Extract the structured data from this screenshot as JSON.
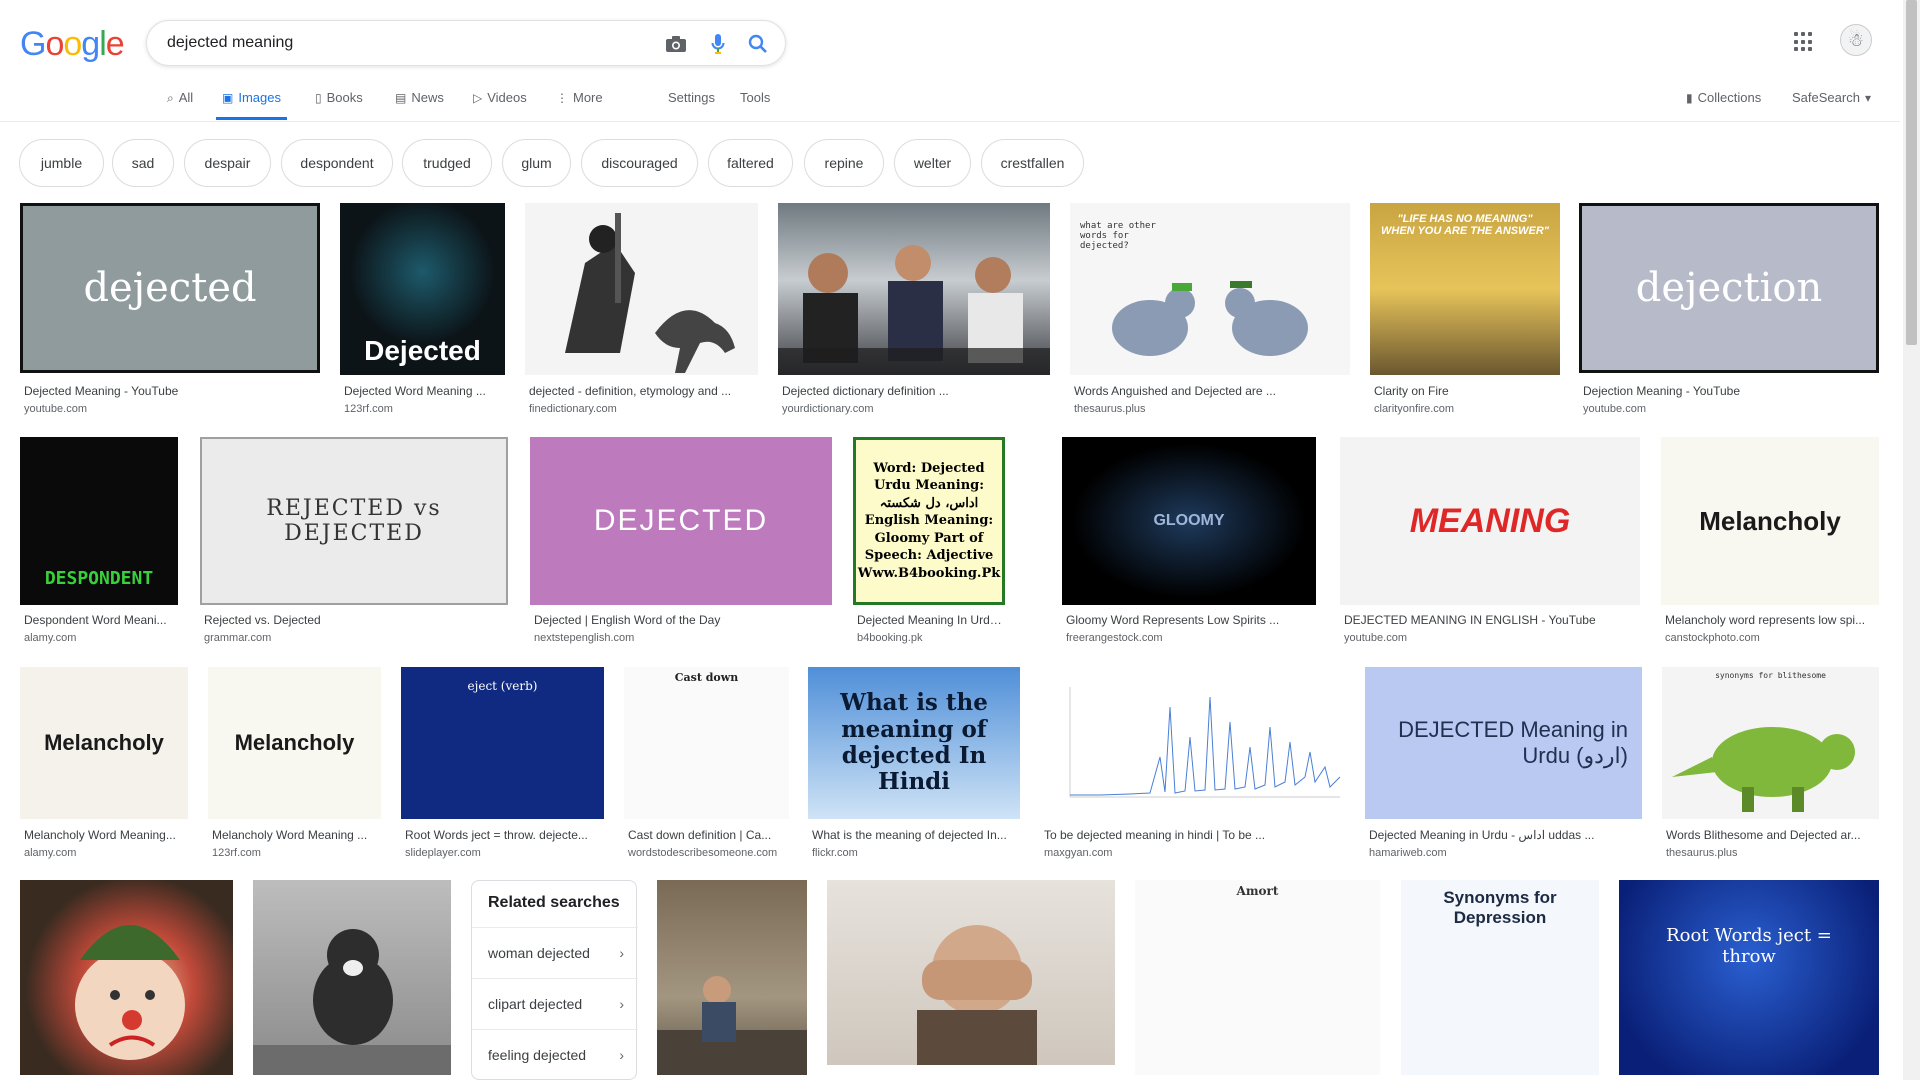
{
  "logo": "Google",
  "search": {
    "query": "dejected meaning"
  },
  "icons": {
    "camera": "camera-icon",
    "mic": "mic-icon",
    "search": "search-icon",
    "apps": "apps-icon",
    "collections": "bookmark-icon"
  },
  "tabs": {
    "all": "All",
    "images": "Images",
    "books": "Books",
    "news": "News",
    "videos": "Videos",
    "more": "More",
    "settings": "Settings",
    "tools": "Tools",
    "collections": "Collections",
    "safesearch": "SafeSearch"
  },
  "chips": [
    "jumble",
    "sad",
    "despair",
    "despondent",
    "trudged",
    "glum",
    "discouraged",
    "faltered",
    "repine",
    "welter",
    "crestfallen"
  ],
  "images": [
    {
      "caption": "Dejected Meaning - YouTube",
      "domain": "youtube.com",
      "text": "dejected"
    },
    {
      "caption": "Dejected Word Meaning ...",
      "domain": "123rf.com",
      "text": "Dejected"
    },
    {
      "caption": "dejected - definition, etymology and ...",
      "domain": "finedictionary.com",
      "text": ""
    },
    {
      "caption": "Dejected dictionary definition ...",
      "domain": "yourdictionary.com",
      "text": ""
    },
    {
      "caption": "Words Anguished and Dejected are ...",
      "domain": "thesaurus.plus",
      "text": "what are other words for dejected?"
    },
    {
      "caption": "Clarity on Fire",
      "domain": "clarityonfire.com",
      "text": "\"LIFE HAS NO MEANING\" WHEN YOU ARE THE ANSWER\""
    },
    {
      "caption": "Dejection Meaning - YouTube",
      "domain": "youtube.com",
      "text": "dejection"
    },
    {
      "caption": "Despondent Word Meani...",
      "domain": "alamy.com",
      "text": "DESPONDENT"
    },
    {
      "caption": "Rejected vs. Dejected",
      "domain": "grammar.com",
      "text": "REJECTED vs DEJECTED"
    },
    {
      "caption": "Dejected | English Word of the Day",
      "domain": "nextstepenglish.com",
      "text": "DEJECTED"
    },
    {
      "caption": "Dejected Meaning In Urdu an...",
      "domain": "b4booking.pk",
      "text": "Word: Dejected Urdu Meaning: اداس، دل شکستہ English Meaning: Gloomy Part of Speech: Adjective Www.B4booking.Pk"
    },
    {
      "caption": "Gloomy Word Represents Low Spirits ...",
      "domain": "freerangestock.com",
      "text": "GLOOMY"
    },
    {
      "caption": "DEJECTED MEANING IN ENGLISH - YouTube",
      "domain": "youtube.com",
      "text": "MEANING"
    },
    {
      "caption": "Melancholy word represents low spi...",
      "domain": "canstockphoto.com",
      "text": "Melancholy"
    },
    {
      "caption": "Melancholy Word Meaning...",
      "domain": "alamy.com",
      "text": "Melancholy"
    },
    {
      "caption": "Melancholy Word Meaning ...",
      "domain": "123rf.com",
      "text": "Melancholy"
    },
    {
      "caption": "Root Words ject = throw. dejecte...",
      "domain": "slideplayer.com",
      "text": "eject (verb)"
    },
    {
      "caption": "Cast down definition | Ca...",
      "domain": "wordstodescribesomeone.com",
      "text": "Cast down"
    },
    {
      "caption": "What is the meaning of dejected In...",
      "domain": "flickr.com",
      "text": "What is the meaning of dejected In Hindi"
    },
    {
      "caption": "To be dejected meaning in hindi | To be ...",
      "domain": "maxgyan.com",
      "text": ""
    },
    {
      "caption": "Dejected Meaning in Urdu - اداس uddas ...",
      "domain": "hamariweb.com",
      "text": "DEJECTED Meaning in Urdu (اردو)"
    },
    {
      "caption": "Words Blithesome and Dejected ar...",
      "domain": "thesaurus.plus",
      "text": "synonyms for blithesome"
    },
    {
      "caption": "",
      "domain": "",
      "text": ""
    },
    {
      "caption": "",
      "domain": "",
      "text": ""
    },
    {
      "caption": "",
      "domain": "",
      "text": ""
    },
    {
      "caption": "",
      "domain": "",
      "text": ""
    },
    {
      "caption": "",
      "domain": "",
      "text": "Amort"
    },
    {
      "caption": "",
      "domain": "",
      "text": "Synonyms for Depression"
    },
    {
      "caption": "",
      "domain": "",
      "text": "Root Words ject = throw"
    }
  ],
  "related": {
    "title": "Related searches",
    "items": [
      "woman dejected",
      "clipart dejected",
      "feeling dejected"
    ]
  }
}
